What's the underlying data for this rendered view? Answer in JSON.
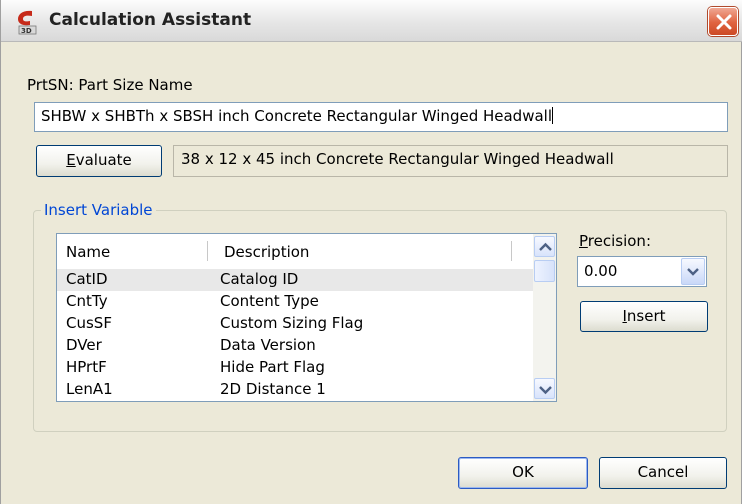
{
  "window": {
    "title": "Calculation Assistant",
    "icon": "civil3d-app-icon",
    "close_icon": "close-x-icon"
  },
  "part_size": {
    "label": "PrtSN: Part Size Name",
    "expression": "SHBW x SHBTh x SBSH inch Concrete Rectangular Winged Headwall",
    "evaluate_label_first": "E",
    "evaluate_label_rest": "valuate",
    "result": "38 x 12 x 45 inch Concrete Rectangular Winged Headwall"
  },
  "insert_variable": {
    "legend": "Insert Variable",
    "columns": [
      "Name",
      "Description"
    ],
    "rows": [
      {
        "name": "CatID",
        "description": "Catalog ID"
      },
      {
        "name": "CntTy",
        "description": "Content Type"
      },
      {
        "name": "CusSF",
        "description": "Custom Sizing Flag"
      },
      {
        "name": "DVer",
        "description": "Data Version"
      },
      {
        "name": "HPrtF",
        "description": "Hide Part Flag"
      },
      {
        "name": "LenA1",
        "description": "2D Distance 1"
      }
    ],
    "selected_row": 0,
    "precision_label_first": "P",
    "precision_label_rest": "recision:",
    "precision_value": "0.00",
    "insert_label_first": "I",
    "insert_label_rest": "nsert"
  },
  "footer": {
    "ok_label": "OK",
    "cancel_label": "Cancel"
  },
  "colors": {
    "dialog_bg": "#ece9d8",
    "group_legend": "#0046d5",
    "close_button": "#e0633f"
  }
}
